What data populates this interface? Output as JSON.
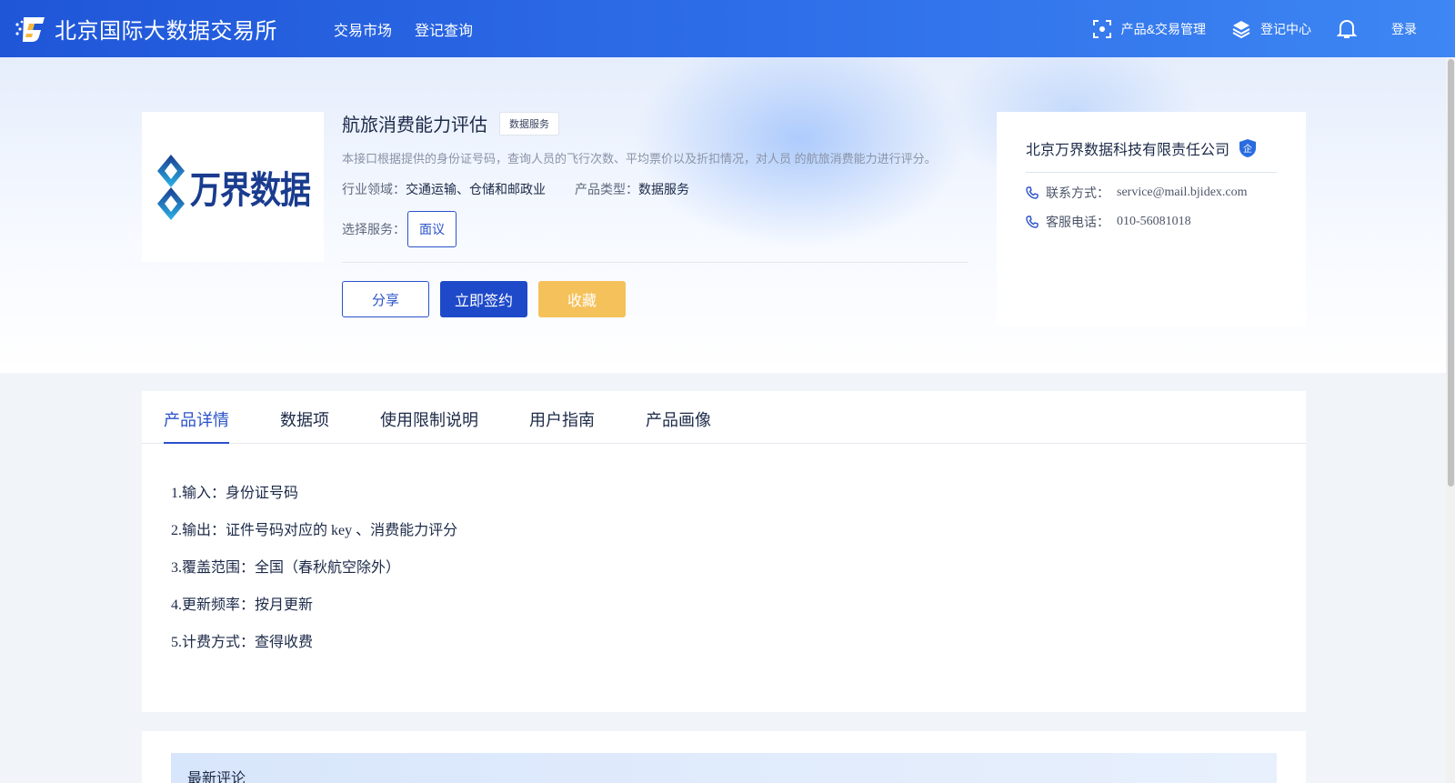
{
  "header": {
    "brand_name": "北京国际大数据交易所",
    "nav": [
      "交易市场",
      "登记查询"
    ],
    "product_mgmt": "产品&交易管理",
    "register_center": "登记中心",
    "login": "登录"
  },
  "product": {
    "logo_text": "万界数据",
    "title": "航旅消费能力评估",
    "tag": "数据服务",
    "description": "本接口根据提供的身份证号码，查询人员的飞行次数、平均票价以及折扣情况，对人员 的航旅消费能力进行评分。",
    "industry_label": "行业领域：",
    "industry_value": "交通运输、仓储和邮政业",
    "type_label": "产品类型：",
    "type_value": "数据服务",
    "service_label": "选择服务：",
    "service_option": "面议",
    "share_button": "分享",
    "sign_button": "立即签约",
    "favorite_button": "收藏"
  },
  "vendor": {
    "name": "北京万界数据科技有限责任公司",
    "badge": "企",
    "contact_label": "联系方式：",
    "contact_value": "service@mail.bjidex.com",
    "phone_label": "客服电话：",
    "phone_value": "010-56081018"
  },
  "tabs": [
    "产品详情",
    "数据项",
    "使用限制说明",
    "用户指南",
    "产品画像"
  ],
  "details": [
    "1.输入：身份证号码",
    "2.输出：证件号码对应的 key 、消费能力评分",
    "3.覆盖范围：全国（春秋航空除外）",
    "4.更新频率：按月更新",
    "5.计费方式：查得收费"
  ],
  "comments": {
    "title": "最新评论"
  },
  "colors": {
    "primary": "#1e49c9",
    "accent_yellow": "#f5c15a",
    "header_start": "#1f56d8",
    "header_end": "#3d86f3"
  }
}
